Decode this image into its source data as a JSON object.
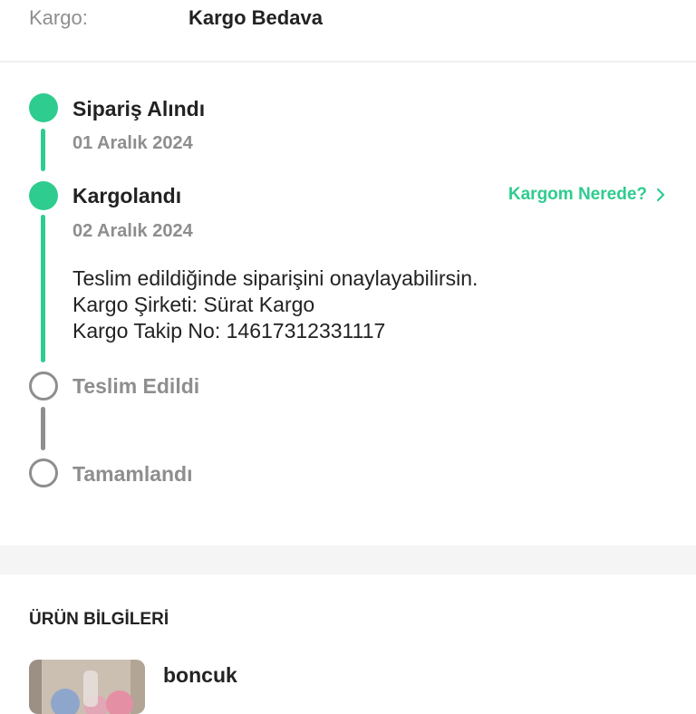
{
  "shipping": {
    "label": "Kargo:",
    "value": "Kargo Bedava"
  },
  "steps": [
    {
      "title": "Sipariş Alındı",
      "date": "01 Aralık 2024",
      "status": "done"
    },
    {
      "title": "Kargolandı",
      "date": "02 Aralık 2024",
      "status": "done",
      "link_label": "Kargom Nerede?",
      "details": [
        "Teslim edildiğinde siparişini onaylayabilirsin.",
        "Kargo Şirketi: Sürat Kargo",
        "Kargo Takip No: 14617312331117"
      ]
    },
    {
      "title": "Teslim Edildi",
      "status": "pending"
    },
    {
      "title": "Tamamlandı",
      "status": "pending"
    }
  ],
  "product_section": {
    "title": "ÜRÜN BİLGİLERİ",
    "product": {
      "name": "boncuk"
    }
  },
  "colors": {
    "accent": "#2ecc8f",
    "muted": "#8e8e8e",
    "text": "#222222",
    "section_bg": "#f5f5f5"
  }
}
